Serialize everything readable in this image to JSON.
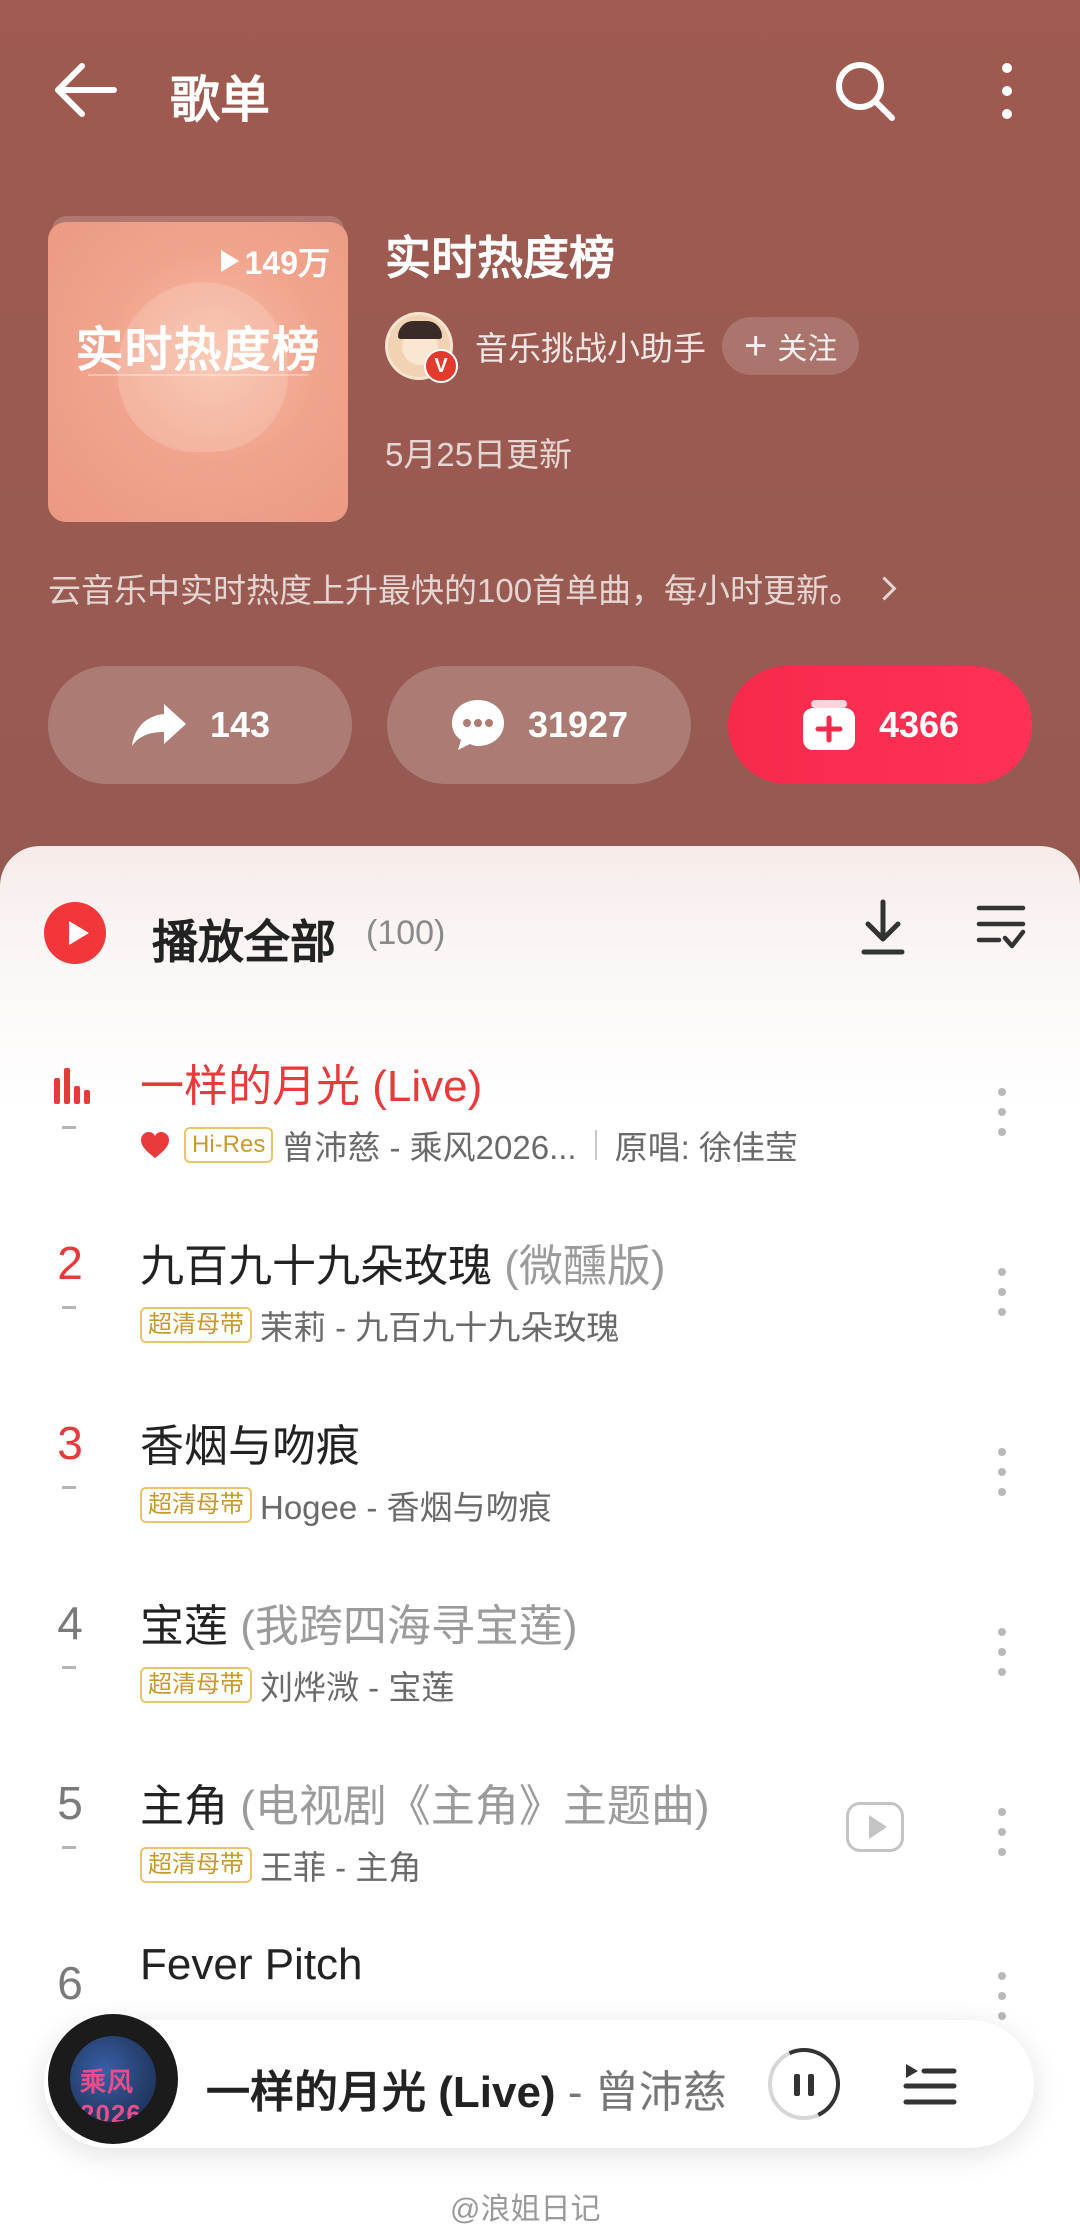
{
  "header": {
    "title": "歌单"
  },
  "playlist": {
    "cover_title": "实时热度榜",
    "play_count": "149万",
    "name": "实时热度榜",
    "creator": "音乐挑战小助手",
    "creator_badge": "V",
    "follow_label": "关注",
    "updated": "5月25日更新",
    "description": "云音乐中实时热度上升最快的100首单曲，每小时更新。"
  },
  "actions": {
    "share": "143",
    "comment": "31927",
    "collect": "4366"
  },
  "list": {
    "play_all_label": "播放全部",
    "count": "(100)",
    "songs": [
      {
        "rank": "",
        "title": "一样的月光 (Live)",
        "subtitle": "",
        "tag": "Hi-Res",
        "meta": "曾沛慈 - 乘风2026...",
        "original": "原唱: 徐佳莹",
        "playing": true
      },
      {
        "rank": "2",
        "title": "九百九十九朵玫瑰",
        "subtitle": "(微醺版)",
        "tag": "超清母带",
        "meta": "茉莉 - 九百九十九朵玫瑰"
      },
      {
        "rank": "3",
        "title": "香烟与吻痕",
        "subtitle": "",
        "tag": "超清母带",
        "meta": "Hogee - 香烟与吻痕"
      },
      {
        "rank": "4",
        "title": "宝莲",
        "subtitle": "(我跨四海寻宝莲)",
        "tag": "超清母带",
        "meta": "刘烨溦 - 宝莲"
      },
      {
        "rank": "5",
        "title": "主角",
        "subtitle": "(电视剧《主角》主题曲)",
        "tag": "超清母带",
        "meta": "王菲 - 主角"
      },
      {
        "rank": "6",
        "title": "Fever Pitch",
        "subtitle": "",
        "tag": "",
        "meta": ""
      }
    ]
  },
  "mini_player": {
    "title": "一样的月光 (Live)",
    "artist": "- 曾沛慈",
    "art_text": "乘风2026"
  },
  "watermark": "@浪姐日记",
  "colors": {
    "accent": "#e8393b",
    "collect": "#f72a4c",
    "header_bg": "#a05a4f"
  }
}
